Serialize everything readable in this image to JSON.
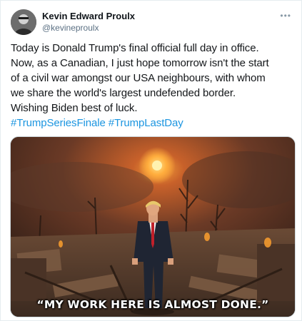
{
  "author": {
    "display_name": "Kevin Edward Proulx",
    "handle": "@kevineproulx",
    "avatar_icon": "profile-photo-icon"
  },
  "menu_icon": "more-options-icon",
  "tweet": {
    "lines": [
      "Today is Donald Trump's final official full day in office.",
      "Now, as a Canadian, I just hope tomorrow isn't the start",
      "of a civil war amongst our USA neighbours, with whom",
      "we share the world's largest undefended border.",
      "Wishing Biden best of luck."
    ],
    "hashtags": [
      "#TrumpSeriesFinale",
      "#TrumpLastDay"
    ]
  },
  "media": {
    "caption": "“MY WORK HERE IS ALMOST DONE.”"
  },
  "colors": {
    "link": "#1b95e0",
    "secondary_text": "#5b7083"
  }
}
